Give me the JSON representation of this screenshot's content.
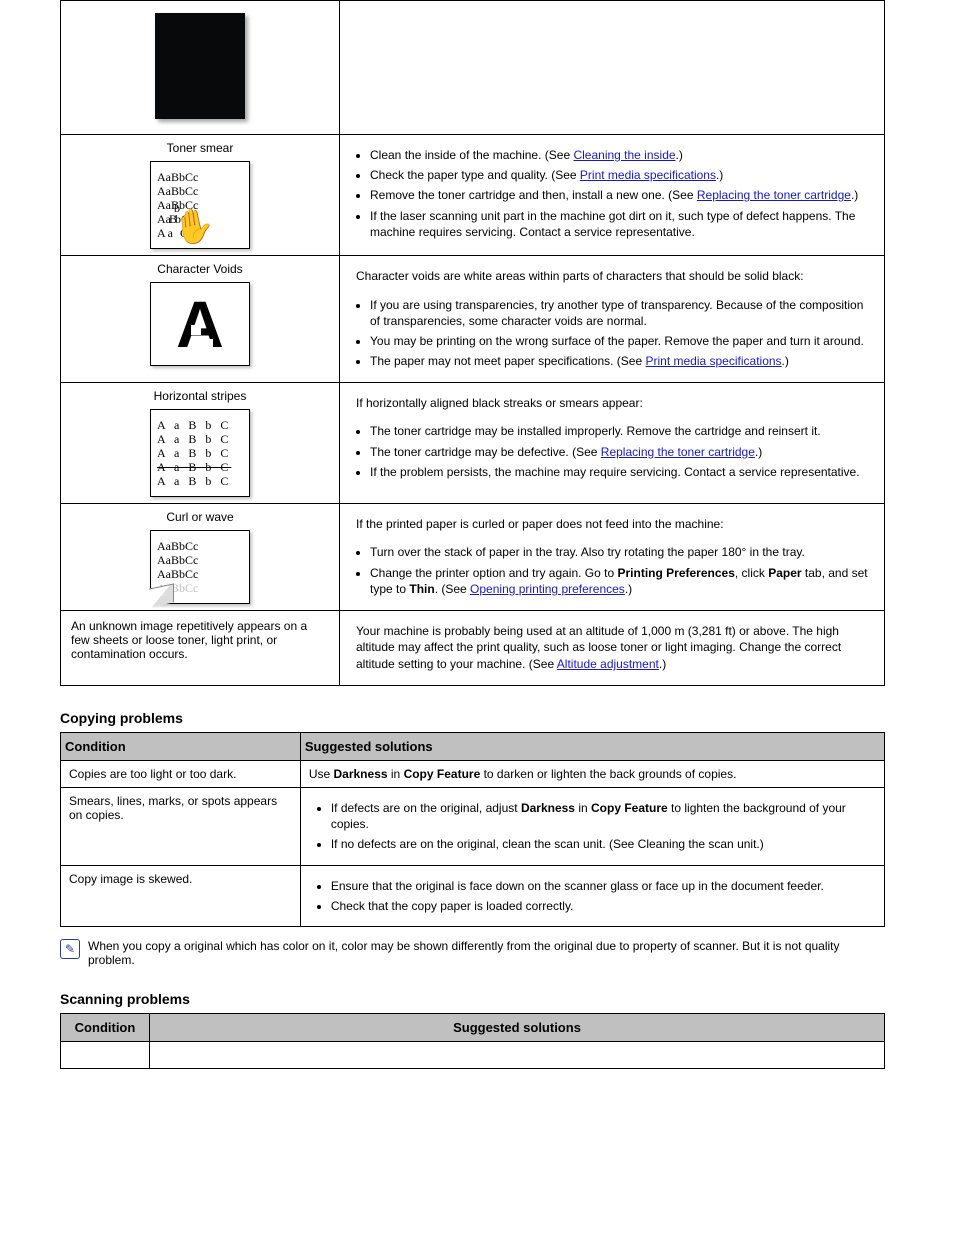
{
  "t1": {
    "rows": [
      {
        "title": "",
        "thumb": "black",
        "items": []
      },
      {
        "title": "Toner smear",
        "thumb": "smear",
        "items": [
          {
            "pre": "Clean the inside of the machine. (See ",
            "link": "Cleaning the inside",
            "post": ".)"
          },
          {
            "pre": "Check the paper type and quality. (See ",
            "link": "Print media specifications",
            "post": ".)"
          },
          {
            "pre": "Remove the toner cartridge and then, install a new one. (See ",
            "link": "Replacing the toner cartridge",
            "post": ".)"
          },
          {
            "plain": "If the laser scanning unit part in the machine got dirt on it, such type of defect happens. The machine requires servicing. Contact a service representative."
          }
        ]
      },
      {
        "title": "Character Voids",
        "thumb": "bigA",
        "intro": "Character voids are white areas within parts of characters that should be solid black:",
        "items": [
          {
            "plain": "If you are using transparencies, try another type of transparency. Because of the composition of transparencies, some character voids are normal."
          },
          {
            "plain": "You may be printing on the wrong surface of the paper. Remove the paper and turn it around."
          },
          {
            "pre": "The paper may not meet paper specifications. (See ",
            "link": "Print media specifications",
            "post": ".)"
          }
        ]
      },
      {
        "title": "Horizontal stripes",
        "thumb": "hstripes",
        "intro": "If horizontally aligned black streaks or smears appear:",
        "items": [
          {
            "pre": "The toner cartridge may be installed improperly. Remove the cartridge and reinsert it."
          },
          {
            "pre": "The toner cartridge may be defective. (See ",
            "link": "Replacing the toner cartridge",
            "post": ".)"
          },
          {
            "plain": "If the problem persists, the machine may require servicing. Contact a service representative."
          }
        ]
      },
      {
        "title": "Curl or wave",
        "thumb": "curl",
        "intro": "If the printed paper is curled or paper does not feed into the machine:",
        "items": [
          {
            "plain": "Turn over the stack of paper in the tray. Also try rotating the paper 180° in the tray."
          },
          {
            "pre": "Change the printer option and try again. Go to ",
            "bold": "Printing Preferences",
            "mid": ", click ",
            "bold2": "Paper",
            "mid2": " tab, and set type to ",
            "bold3": "Thin",
            "post2": ". (See ",
            "link": "Opening printing preferences",
            "post": ".)"
          }
        ]
      },
      {
        "title": "An unknown image repetitively appears on a few sheets or loose toner, light print, or contamination occurs.",
        "thumb": "none",
        "para": "Your machine is probably being used at an altitude of 1,000 m (3,281 ft) or above. The high altitude may affect the print quality, such as loose toner or light imaging. Change the correct altitude setting to your machine. (See Altitude adjustment",
        "link": "Altitude adjustment",
        "post": ".)",
        "para_pre": "Your machine is probably being used at an altitude of 1,000 m (3,281 ft) or above. The high altitude may affect the print quality, such as loose toner or light imaging. Change the correct altitude setting to your machine. (See "
      }
    ]
  },
  "h_copy": "Copying problems",
  "t2": {
    "head": {
      "c1": "Condition",
      "c2": "Suggested solutions"
    },
    "rows": [
      {
        "c1": "Copies are too light or too dark.",
        "c2_pre": "Use ",
        "c2_b": "Darkness",
        "c2_mid": " in ",
        "c2_b2": "Copy Feature",
        "c2_post": " to darken or lighten the back grounds of copies."
      },
      {
        "c1": "Smears, lines, marks, or spots appears on copies.",
        "c2_list": [
          {
            "pre": "If defects are on the original, adjust ",
            "b": "Darkness",
            "mid": " in ",
            "b2": "Copy Feature",
            "post": " to lighten the background of your copies."
          },
          {
            "plain": "If no defects are on the original, clean the scan unit. (See Cleaning the scan unit.)"
          }
        ]
      },
      {
        "c1": "Copy image is skewed.",
        "c2_list": [
          {
            "plain": "Ensure that the original is face down on the scanner glass or face up in the document feeder."
          },
          {
            "plain": "Check that the copy paper is loaded correctly."
          }
        ]
      }
    ]
  },
  "note": "When you copy a original which has color on it, color may be shown differently from the original due to property of scanner. But it is not quality problem.",
  "h_scan": "Scanning problems",
  "t3": {
    "head": {
      "c1": "Condition",
      "c2": "Suggested solutions"
    }
  }
}
